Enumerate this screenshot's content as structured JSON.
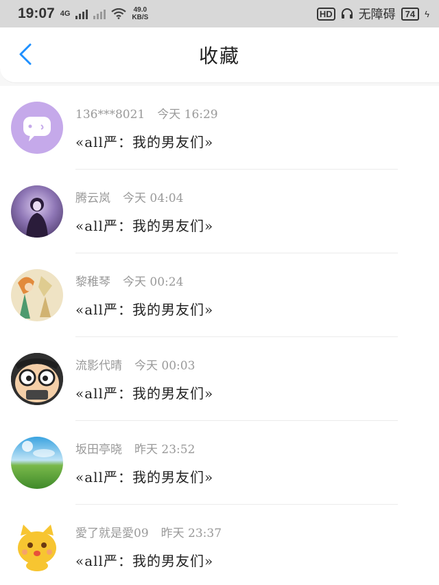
{
  "status_bar": {
    "time": "19:07",
    "network": "4G",
    "speed_value": "49.0",
    "speed_unit": "KB/S",
    "hd": "HD",
    "accessibility": "无障碍",
    "battery": "74"
  },
  "header": {
    "title": "收藏"
  },
  "items": [
    {
      "name": "136***8021",
      "time": "今天 16:29",
      "message": "«all严：我的男友们»"
    },
    {
      "name": "腾云岚",
      "time": "今天 04:04",
      "message": "«all严：我的男友们»"
    },
    {
      "name": "黎稚琴",
      "time": "今天 00:24",
      "message": "«all严：我的男友们»"
    },
    {
      "name": "流影代晴",
      "time": "今天 00:03",
      "message": "«all严：我的男友们»"
    },
    {
      "name": "坂田亭晓",
      "time": "昨天 23:52",
      "message": "«all严：我的男友们»"
    },
    {
      "name": "愛了就是愛09",
      "time": "昨天 23:37",
      "message": "«all严：我的男友们»"
    }
  ],
  "colors": {
    "accent": "#1e90ff",
    "name_gray": "#999999"
  },
  "icons": [
    "back-chevron-icon",
    "headphone-icon",
    "wifi-icon",
    "signal-icon"
  ]
}
